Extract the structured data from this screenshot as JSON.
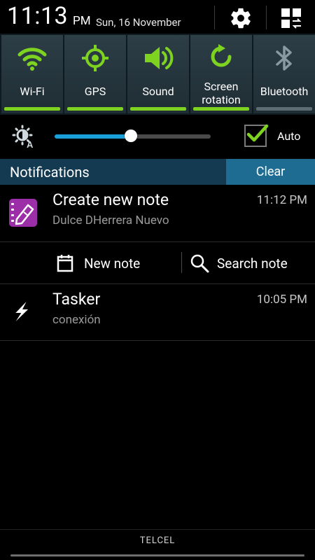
{
  "status": {
    "time": "11:13",
    "ampm": "PM",
    "date": "Sun, 16 November"
  },
  "quick_settings": {
    "tiles": [
      {
        "label": "Wi-Fi",
        "active": true,
        "icon": "wifi-icon"
      },
      {
        "label": "GPS",
        "active": true,
        "icon": "gps-icon"
      },
      {
        "label": "Sound",
        "active": true,
        "icon": "sound-icon"
      },
      {
        "label": "Screen rotation",
        "line1": "Screen",
        "line2": "rotation",
        "active": true,
        "icon": "screen-rotation-icon"
      },
      {
        "label": "Bluetooth",
        "active": false,
        "icon": "bluetooth-icon"
      }
    ],
    "active_color": "#7ed321",
    "inactive_color": "#7a8a92"
  },
  "brightness": {
    "level_percent": 49,
    "auto_label": "Auto",
    "auto_checked": true,
    "accent_color": "#1aa0d9"
  },
  "notifications_panel": {
    "title": "Notifications",
    "clear_label": "Clear"
  },
  "notifications": [
    {
      "app_icon": "note-pen-icon",
      "title": "Create new note",
      "subtitle": "Dulce DHerrera Nuevo",
      "time": "11:12 PM",
      "actions": [
        {
          "label": "New note",
          "icon": "new-note-icon"
        },
        {
          "label": "Search note",
          "icon": "search-icon"
        }
      ]
    },
    {
      "app_icon": "tasker-bolt-icon",
      "title": "Tasker",
      "subtitle": "conexión",
      "time": "10:05 PM"
    }
  ],
  "carrier": "TELCEL"
}
